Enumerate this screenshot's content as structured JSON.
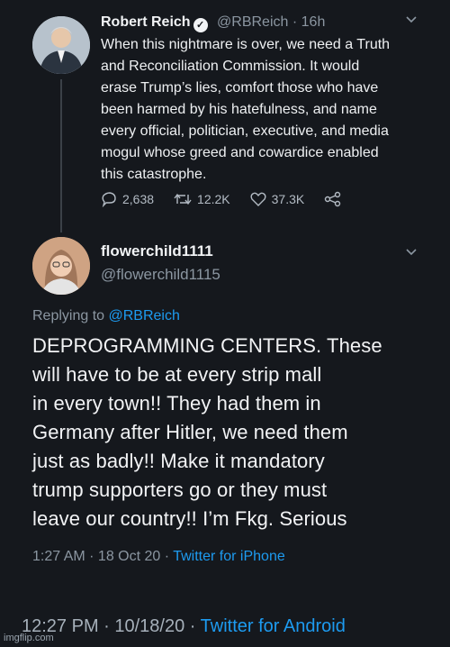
{
  "tweet1": {
    "name": "Robert Reich",
    "handle": "@RBReich",
    "separator": "·",
    "time": "16h",
    "lines": [
      "When this nightmare is over, we need a Truth",
      "and Reconciliation Commission. It would",
      "erase Trump’s lies, comfort those who have",
      "been harmed by his hatefulness, and name",
      "every official, politician, executive, and media",
      "mogul whose greed and cowardice enabled",
      "this catastrophe."
    ],
    "replies": "2,638",
    "retweets": "12.2K",
    "likes": "37.3K"
  },
  "tweet2": {
    "name": "flowerchild1111",
    "handle": "@flowerchild1115",
    "replying_prefix": "Replying to",
    "replying_to": "@RBReich",
    "lines": [
      "DEPROGRAMMING CENTERS. These",
      "will have to be at every strip mall",
      "in every town!! They had them in",
      "Germany after Hitler, we need them",
      "just as badly!! Make it mandatory",
      "trump supporters go or they must",
      "leave our country!! I’m Fkg. Serious"
    ],
    "timestamp": "1:27 AM · 18 Oct 20 ·",
    "source": "Twitter for iPhone"
  },
  "footer": {
    "timestamp": "12:27 PM · 10/18/20 ·",
    "source": "Twitter for Android"
  },
  "watermark": "imgflip.com",
  "colors": {
    "background": "#15181d",
    "link": "#1d9bf0",
    "muted": "#8b96a1"
  }
}
